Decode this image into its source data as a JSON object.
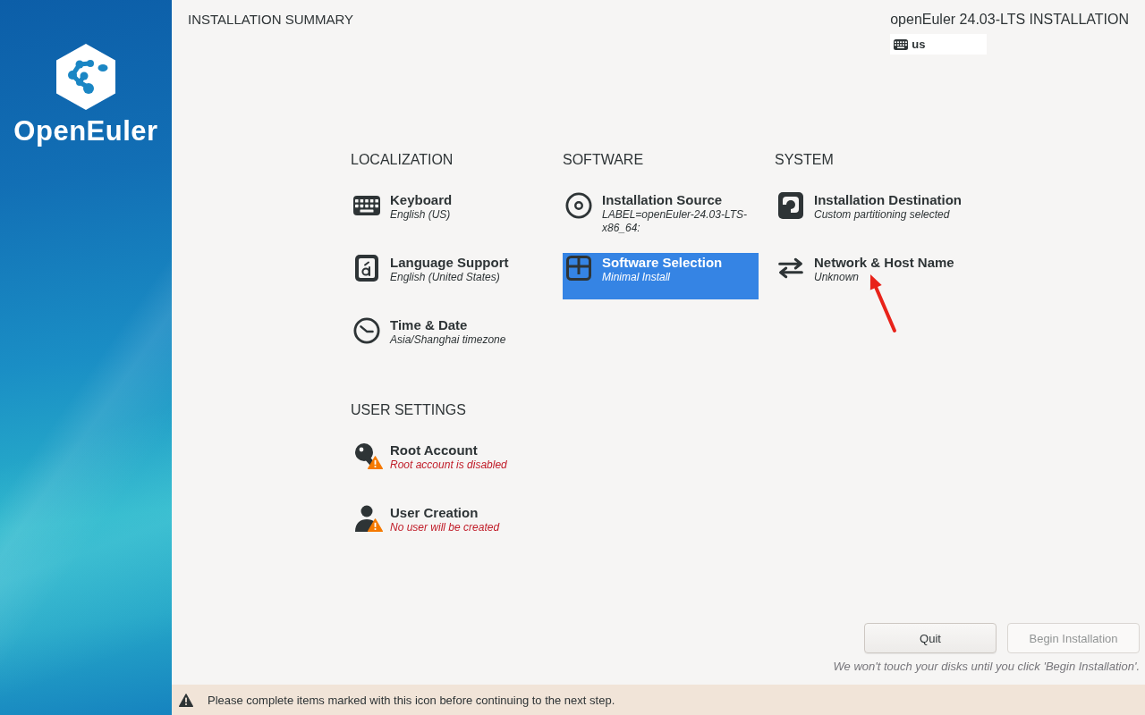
{
  "sidebar": {
    "logo_text": "OpenEuler"
  },
  "header": {
    "title": "INSTALLATION SUMMARY",
    "product": "openEuler 24.03-LTS INSTALLATION",
    "keyboard_layout": "us"
  },
  "categories": [
    {
      "title": "LOCALIZATION",
      "spokes": [
        {
          "kind": "keyboard",
          "title": "Keyboard",
          "status": "English (US)",
          "selected": false,
          "warning": false
        },
        {
          "kind": "language",
          "title": "Language Support",
          "status": "English (United States)",
          "selected": false,
          "warning": false
        },
        {
          "kind": "time",
          "title": "Time & Date",
          "status": "Asia/Shanghai timezone",
          "selected": false,
          "warning": false
        }
      ]
    },
    {
      "title": "SOFTWARE",
      "spokes": [
        {
          "kind": "source",
          "title": "Installation Source",
          "status": "LABEL=openEuler-24.03-LTS-x86_64:",
          "selected": false,
          "warning": false
        },
        {
          "kind": "software",
          "title": "Software Selection",
          "status": "Minimal Install",
          "selected": true,
          "warning": false
        }
      ]
    },
    {
      "title": "SYSTEM",
      "spokes": [
        {
          "kind": "destination",
          "title": "Installation Destination",
          "status": "Custom partitioning selected",
          "selected": false,
          "warning": false
        },
        {
          "kind": "network",
          "title": "Network & Host Name",
          "status": "Unknown",
          "selected": false,
          "warning": false
        }
      ]
    },
    {
      "title": "USER SETTINGS",
      "spokes": [
        {
          "kind": "root",
          "title": "Root Account",
          "status": "Root account is disabled",
          "selected": false,
          "warning": true
        },
        {
          "kind": "user",
          "title": "User Creation",
          "status": "No user will be created",
          "selected": false,
          "warning": true
        }
      ]
    }
  ],
  "buttons": [
    {
      "label": "Quit",
      "disabled": false
    },
    {
      "label": "Begin Installation",
      "disabled": true
    }
  ],
  "footnote": "We won't touch your disks until you click 'Begin Installation'.",
  "warning_bar": {
    "message": "Please complete items marked with this icon before continuing to the next step."
  }
}
